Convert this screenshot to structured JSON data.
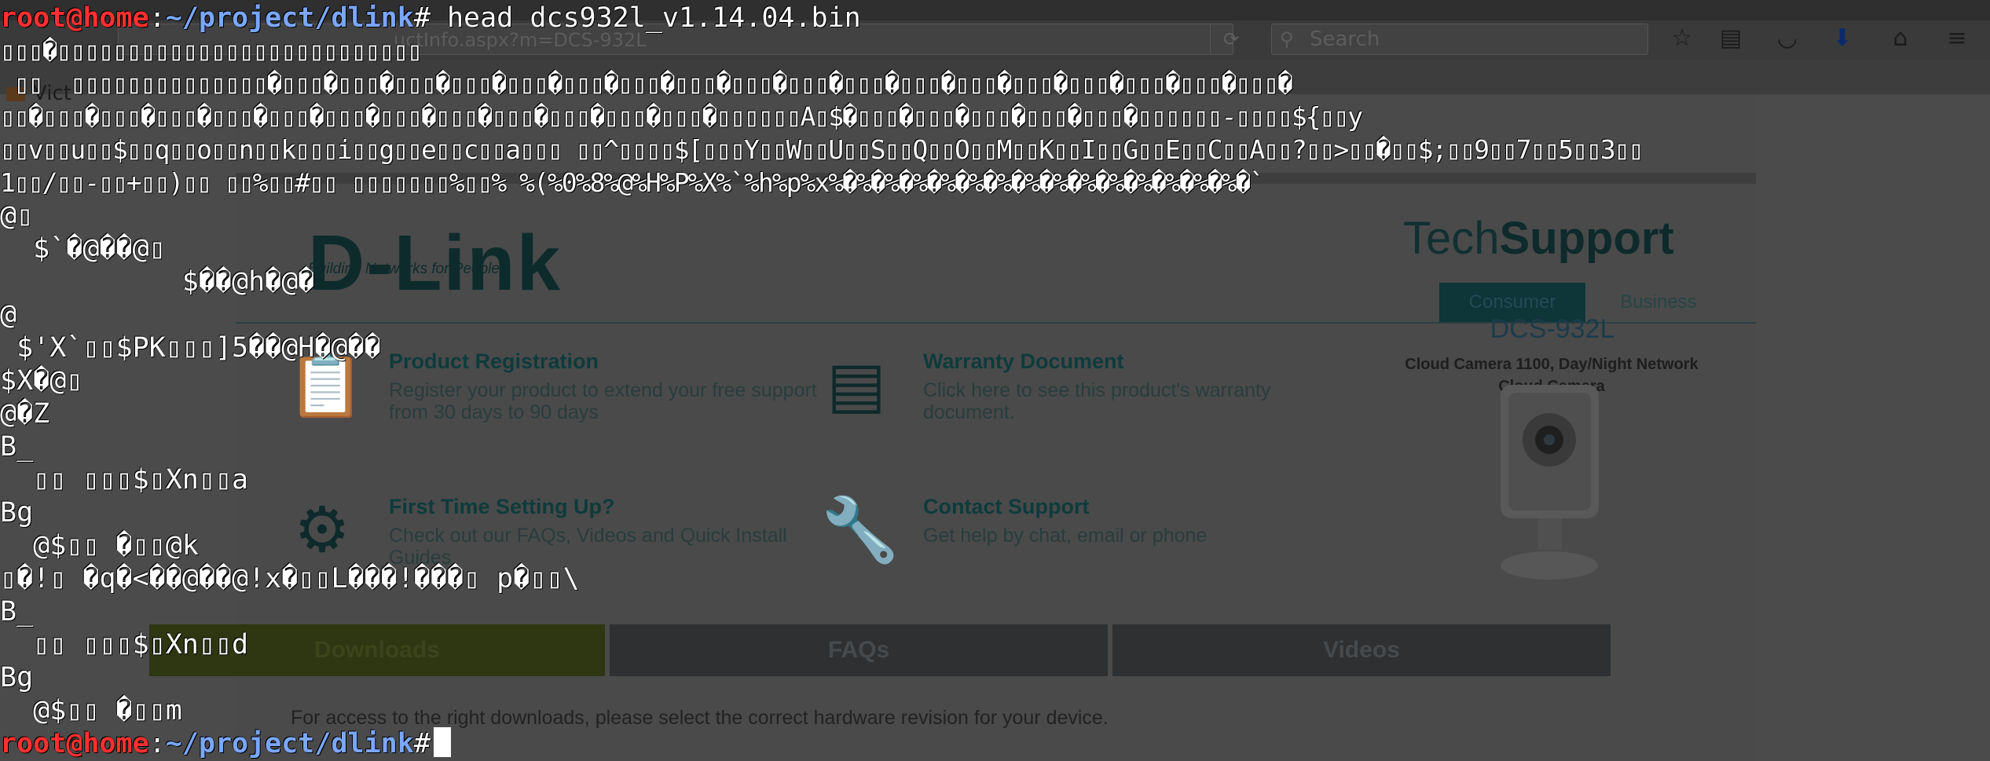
{
  "browser": {
    "url_fragment": "uctInfo.aspx?m=DCS-932L",
    "search_placeholder": "Search",
    "bookmark_label": "Vict",
    "toolbar_icons": [
      "reload-icon",
      "star-icon",
      "clipboard-icon",
      "pocket-icon",
      "download-icon",
      "home-icon",
      "menu-icon"
    ]
  },
  "webpage": {
    "logo": "D-Link",
    "tagline": "Building Networks for People",
    "techsupport_light": "Tech",
    "techsupport_bold": "Support",
    "tabs": [
      "Consumer",
      "Business"
    ],
    "features": [
      {
        "title": "Product Registration",
        "desc": "Register your product to extend your free support from 30 days to 90 days",
        "icon": "clipboard-check-icon"
      },
      {
        "title": "Warranty Document",
        "desc": "Click here to see this product's warranty document.",
        "icon": "document-icon"
      },
      {
        "title": "First Time Setting Up?",
        "desc": "Check out our FAQs, Videos and Quick Install Guides",
        "icon": "gears-icon"
      },
      {
        "title": "Contact Support",
        "desc": "Get help by chat, email or phone",
        "icon": "wrench-icon"
      }
    ],
    "product_name": "DCS-932L",
    "product_desc_1": "Cloud Camera 1100, Day/Night Network",
    "product_desc_2": "Cloud Camera",
    "download_tabs": [
      "Downloads",
      "FAQs",
      "Videos"
    ],
    "downloads_info": "For access to the right downloads, please select the correct hardware revision for your device."
  },
  "terminal": {
    "prompt_user": "root@home",
    "prompt_path": "~/project/dlink",
    "prompt_hash": "#",
    "command": " head dcs932l_v1.14.04.bin",
    "output": [
      "▯▯▯�▯▯▯▯▯▯▯▯▯▯▯▯▯▯▯▯▯▯▯▯▯▯▯▯▯▯",
      " ▯▯  ▯▯▯▯▯▯▯▯▯▯▯▯▯▯�▯▯▯�▯▯▯�▯▯▯�▯▯▯�▯▯▯�▯▯▯�▯▯▯�▯▯▯�▯▯▯�▯▯▯�▯▯▯�▯▯▯�▯▯▯�▯▯▯�▯▯▯�▯▯▯�▯▯▯�▯▯▯�",
      "▯▯�▯▯▯�▯▯▯�▯▯▯�▯▯▯�▯▯▯�▯▯▯�▯▯▯�▯▯▯�▯▯▯�▯▯▯�▯▯▯�▯▯▯�▯▯▯▯▯▯A▯$�▯▯▯�▯▯▯�▯▯▯�▯▯▯�▯▯▯�▯▯▯▯▯▯-▯▯▯▯${▯▯y",
      "▯▯v▯▯u▯▯$▯▯q▯▯o▯▯n▯▯k▯▯▯i▯▯g▯▯e▯▯c▯▯a▯▯▯ ▯▯^▯▯▯▯$[▯▯▯Y▯▯W▯▯U▯▯S▯▯Q▯▯O▯▯M▯▯K▯▯I▯▯G▯▯E▯▯C▯▯A▯▯?▯▯>▯▯�▯▯$;▯▯9▯▯7▯▯5▯▯3▯▯",
      "1▯▯/▯▯-▯▯+▯▯)▯▯ ▯▯%▯▯#▯▯ ▯▯▯▯▯▯▯%▯▯% %(%0%8%@%H%P%X%`%h%p%x%�%�%�%�%�%�%�%�%�%�%�%�%�%�%�`",
      "@▯",
      "  $`�@��@▯",
      "           $��@h�@�",
      "@",
      " $'X`▯▯$PK▯▯▯]5��@H�@��",
      "$X�@▯",
      "@�Z",
      "B_",
      "  ▯▯ ▯▯▯$▯Xn▯▯a",
      "Bg",
      "  @$▯▯ �▯▯@k",
      "▯�!▯ �q�<��@��@!x�▯▯L���!���▯ p�▯▯\\",
      "B_",
      "  ▯▯ ▯▯▯$▯Xn▯▯d",
      "Bg",
      "  @$▯▯ �▯▯m"
    ]
  }
}
